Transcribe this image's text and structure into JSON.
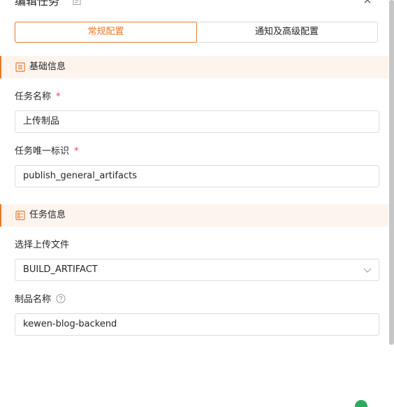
{
  "header": {
    "title": "编辑任务",
    "icons": {
      "title": "document-icon",
      "close": "close-icon"
    }
  },
  "tabs": [
    {
      "label": "常规配置",
      "active": true
    },
    {
      "label": "通知及高级配置",
      "active": false
    }
  ],
  "sections": {
    "basic": {
      "label": "基础信息",
      "icon": "list-icon"
    },
    "task": {
      "label": "任务信息",
      "icon": "checklist-icon"
    }
  },
  "fields": {
    "task_name": {
      "label": "任务名称",
      "required": "*",
      "value": "上传制品"
    },
    "task_id": {
      "label": "任务唯一标识",
      "required": "*",
      "value": "publish_general_artifacts"
    },
    "upload_file": {
      "label": "选择上传文件",
      "value": "BUILD_ARTIFACT"
    },
    "artifact_name": {
      "label": "制品名称",
      "value": "kewen-blog-backend",
      "help_icon": "question-circle-icon"
    }
  },
  "colors": {
    "accent": "#e87a2b",
    "section_bg": "#fdf4ee",
    "required": "#e5484d",
    "border": "#dcdcdc"
  }
}
